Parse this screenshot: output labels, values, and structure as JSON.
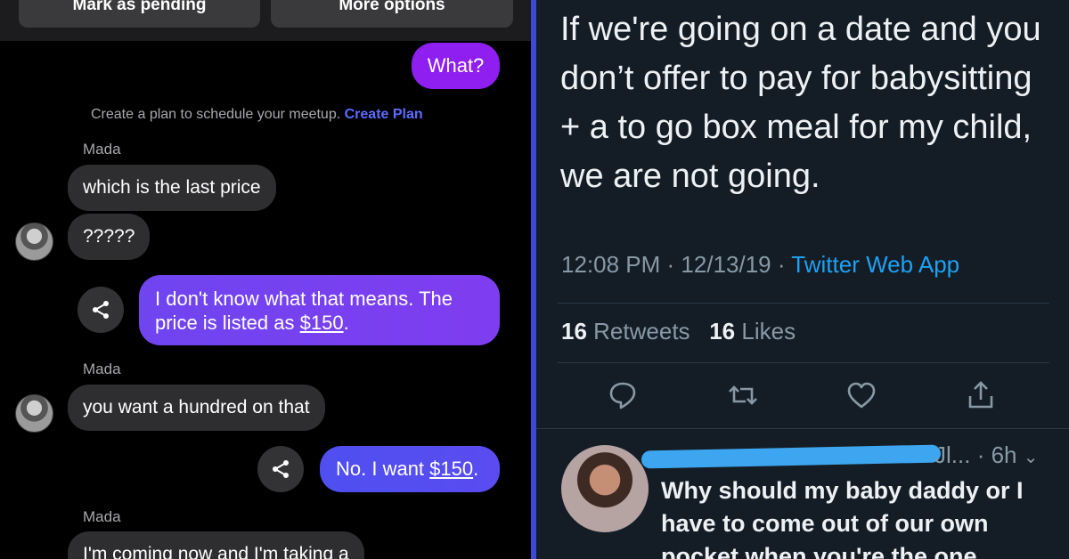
{
  "chat": {
    "top_buttons": {
      "mark_pending": "Mark as pending",
      "more_options": "More options"
    },
    "messages": {
      "what": "What?",
      "plan_text": "Create a plan to schedule your meetup.",
      "plan_link": "Create Plan",
      "sender1": "Mada",
      "msg1": "which is the last price",
      "msg2": "?????",
      "me2_part1": "I don't know what that means. The",
      "me2_part2": "price is listed as ",
      "me2_price": "$150",
      "me2_end": ".",
      "sender2": "Mada",
      "msg3": "you want a hundred on that",
      "me3_part1": "No. I want ",
      "me3_price": "$150",
      "me3_end": ".",
      "sender3": "Mada",
      "msg4": "I'm coming now and I'm taking a"
    }
  },
  "tweet": {
    "text": "If we're going on a date and you don’t offer to pay for babysitting + a to go box meal for my child, we are not going.",
    "time": "12:08 PM",
    "date": "12/13/19",
    "app": "Twitter Web App",
    "retweets_count": "16",
    "retweets_label": "Retweets",
    "likes_count": "16",
    "likes_label": "Likes",
    "icons": [
      "reply-icon",
      "retweet-icon",
      "like-icon",
      "share-icon"
    ],
    "reply": {
      "handle_tail": "Jl...",
      "time": "· 6h",
      "text": "Why should my baby daddy or I have to come out of our own pocket when you're the one"
    }
  },
  "colors": {
    "my_bubble": "#7a40f0",
    "their_bubble": "#2e2e30",
    "link_blue": "#5b6cff",
    "divider": "#3d4ad8",
    "tweet_bg": "#141d26",
    "twitter_blue": "#1da1f2"
  }
}
